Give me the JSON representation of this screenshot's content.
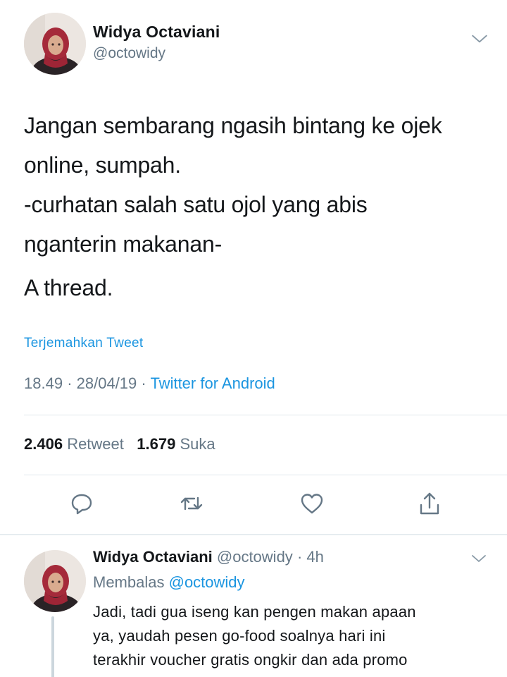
{
  "main_tweet": {
    "author_name": "Widya Octaviani",
    "author_handle": "@octowidy",
    "text_lines": [
      "Jangan sembarang ngasih bintang ke ojek",
      "online, sumpah.",
      "-curhatan salah satu ojol yang abis",
      "nganterin makanan-",
      "A thread."
    ],
    "translate_label": "Terjemahkan Tweet",
    "time": "18.49",
    "date": "28/04/19",
    "source": "Twitter for Android",
    "retweet_count": "2.406",
    "retweet_label": "Retweet",
    "like_count": "1.679",
    "like_label": "Suka"
  },
  "reply_tweet": {
    "author_name": "Widya Octaviani",
    "author_handle": "@octowidy",
    "age": "4h",
    "replying_prefix": "Membalas",
    "replying_to": "@octowidy",
    "text_lines": [
      "Jadi, tadi gua iseng kan pengen makan apaan",
      "ya, yaudah pesen go-food soalnya hari ini",
      "terakhir voucher gratis ongkir dan ada promo"
    ]
  },
  "icons": {
    "menu": "chevron-down-icon",
    "reply": "reply-icon",
    "retweet": "retweet-icon",
    "like": "heart-icon",
    "share": "share-icon"
  },
  "colors": {
    "link": "#1b95e0",
    "secondary_text": "#657786",
    "primary_text": "#14171a",
    "divider": "#e1e8ed",
    "icon": "#657786"
  }
}
